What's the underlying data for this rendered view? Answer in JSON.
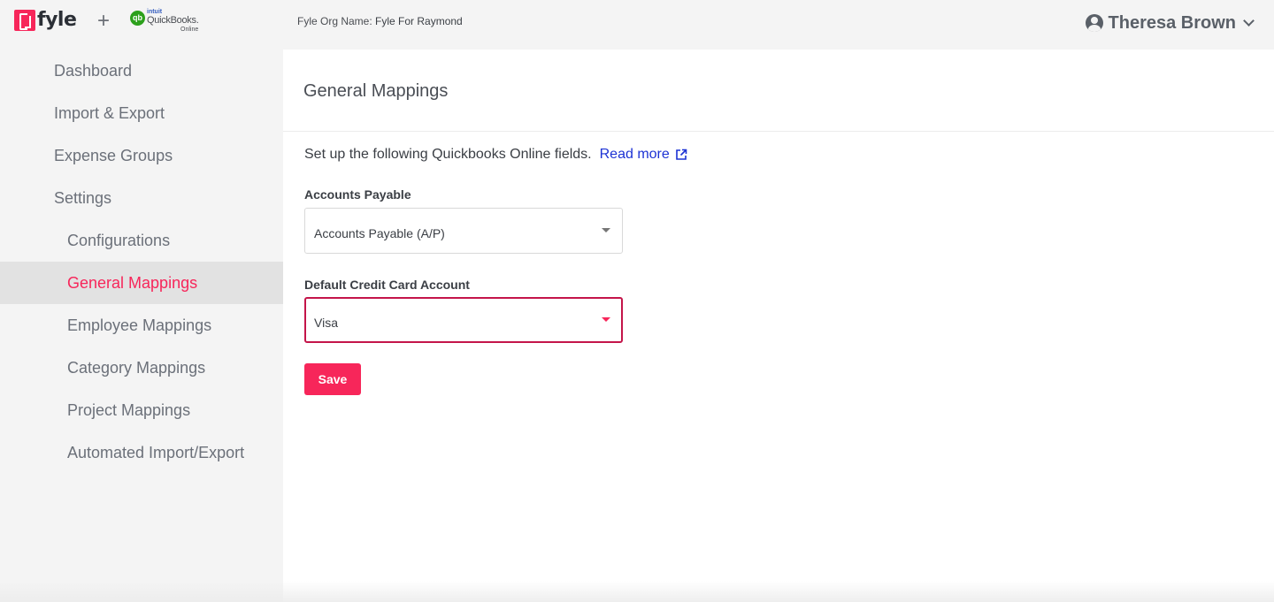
{
  "header": {
    "brand": "fyle",
    "plus": "+",
    "qbo": {
      "badge": "qb",
      "intuit": "intuit",
      "name": "QuickBooks.",
      "sub": "Online"
    },
    "org_label": "Fyle Org Name:",
    "org_value": "Fyle For Raymond",
    "user_name": "Theresa Brown"
  },
  "sidebar": {
    "items": [
      {
        "label": "Dashboard"
      },
      {
        "label": "Import & Export"
      },
      {
        "label": "Expense Groups"
      },
      {
        "label": "Settings"
      },
      {
        "label": "Configurations"
      },
      {
        "label": "General Mappings",
        "active": true
      },
      {
        "label": "Employee Mappings"
      },
      {
        "label": "Category Mappings"
      },
      {
        "label": "Project Mappings"
      },
      {
        "label": "Automated Import/Export"
      }
    ]
  },
  "main": {
    "title": "General Mappings",
    "intro": "Set up the following Quickbooks Online fields.",
    "read_more": "Read more",
    "fields": [
      {
        "label": "Accounts Payable",
        "value": "Accounts Payable (A/P)"
      },
      {
        "label": "Default Credit Card Account",
        "value": "Visa"
      }
    ],
    "save_label": "Save"
  },
  "colors": {
    "accent": "#f7265a",
    "focus_border": "#c4154a",
    "link": "#1c32d4",
    "sidebar_bg": "#f4f4f4",
    "active_bg": "#e2e2e2"
  },
  "icons": [
    "plus-icon",
    "user-icon",
    "chevron-down-icon",
    "external-link-icon",
    "caret-icon"
  ]
}
